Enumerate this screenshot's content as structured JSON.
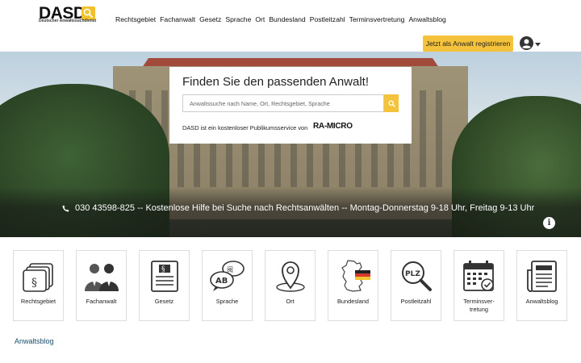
{
  "header": {
    "logo_text": "DASD",
    "logo_subtitle": "Deutscher Anwaltssuchdienst",
    "nav": [
      "Rechtsgebiet",
      "Fachanwalt",
      "Gesetz",
      "Sprache",
      "Ort",
      "Bundesland",
      "Postleitzahl",
      "Terminsvertretung",
      "Anwaltsblog"
    ],
    "register_label": "Jetzt als Anwalt registrieren"
  },
  "hero": {
    "title": "Finden Sie den passenden Anwalt!",
    "search_placeholder": "Anwaltssuche nach Name, Ort, Rechtsgebiet, Sprache",
    "service_text": "DASD ist ein kostenloser Publikumsservice von",
    "service_brand": "RA-MICRO",
    "phone_text": "030 43598-825 -- Kostenlose Hilfe bei Suche nach Rechtsanwälten -- Montag-Donnerstag 9-18 Uhr, Freitag 9-13 Uhr",
    "info_glyph": "i"
  },
  "categories": [
    {
      "label": "Rechtsgebiet",
      "icon": "section-docs-icon"
    },
    {
      "label": "Fachanwalt",
      "icon": "lawyers-icon"
    },
    {
      "label": "Gesetz",
      "icon": "law-book-icon"
    },
    {
      "label": "Sprache",
      "icon": "language-icon"
    },
    {
      "label": "Ort",
      "icon": "location-pin-icon"
    },
    {
      "label": "Bundesland",
      "icon": "germany-map-icon"
    },
    {
      "label": "Postleitzahl",
      "icon": "postcode-search-icon"
    },
    {
      "label": "Terminsver-\ntretung",
      "icon": "calendar-icon"
    },
    {
      "label": "Anwaltsblog",
      "icon": "newspaper-icon"
    }
  ],
  "blog_heading": "Anwaltsblog",
  "colors": {
    "accent": "#f5c33b",
    "link": "#1a4d6e"
  }
}
